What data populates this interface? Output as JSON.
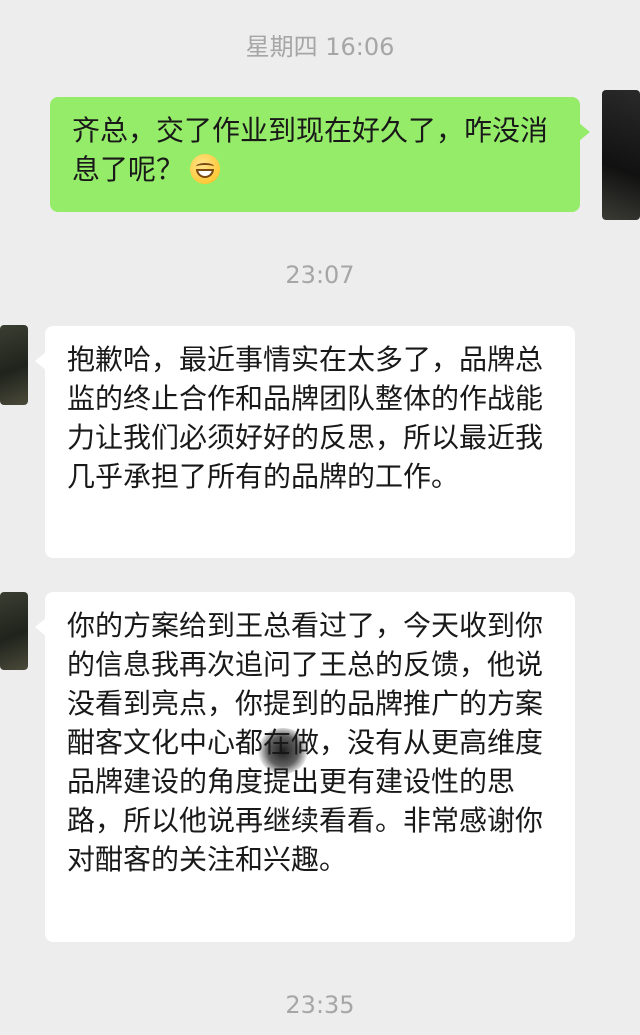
{
  "timestamps": {
    "first": "星期四 16:06",
    "second": "23:07",
    "third": "23:35"
  },
  "messages": [
    {
      "side": "sent",
      "text": "齐总，交了作业到现在好久了，咋没消息了呢？",
      "emoji": "grinning-face-emoji"
    },
    {
      "side": "received",
      "text": "抱歉哈，最近事情实在太多了，品牌总监的终止合作和品牌团队整体的作战能力让我们必须好好的反思，所以最近我几乎承担了所有的品牌的工作。"
    },
    {
      "side": "received",
      "text": "你的方案给到王总看过了，今天收到你的信息我再次追问了王总的反馈，他说没看到亮点，你提到的品牌推广的方案酣客文化中心都在做，没有从更高维度品牌建设的角度提出更有建设性的思路，所以他说再继续看看。非常感谢你对酣客的关注和兴趣。"
    }
  ],
  "colors": {
    "background": "#ededed",
    "sent_bubble": "#95ec69",
    "received_bubble": "#ffffff",
    "timestamp_text": "#a6a6a6",
    "message_text": "#191919"
  }
}
